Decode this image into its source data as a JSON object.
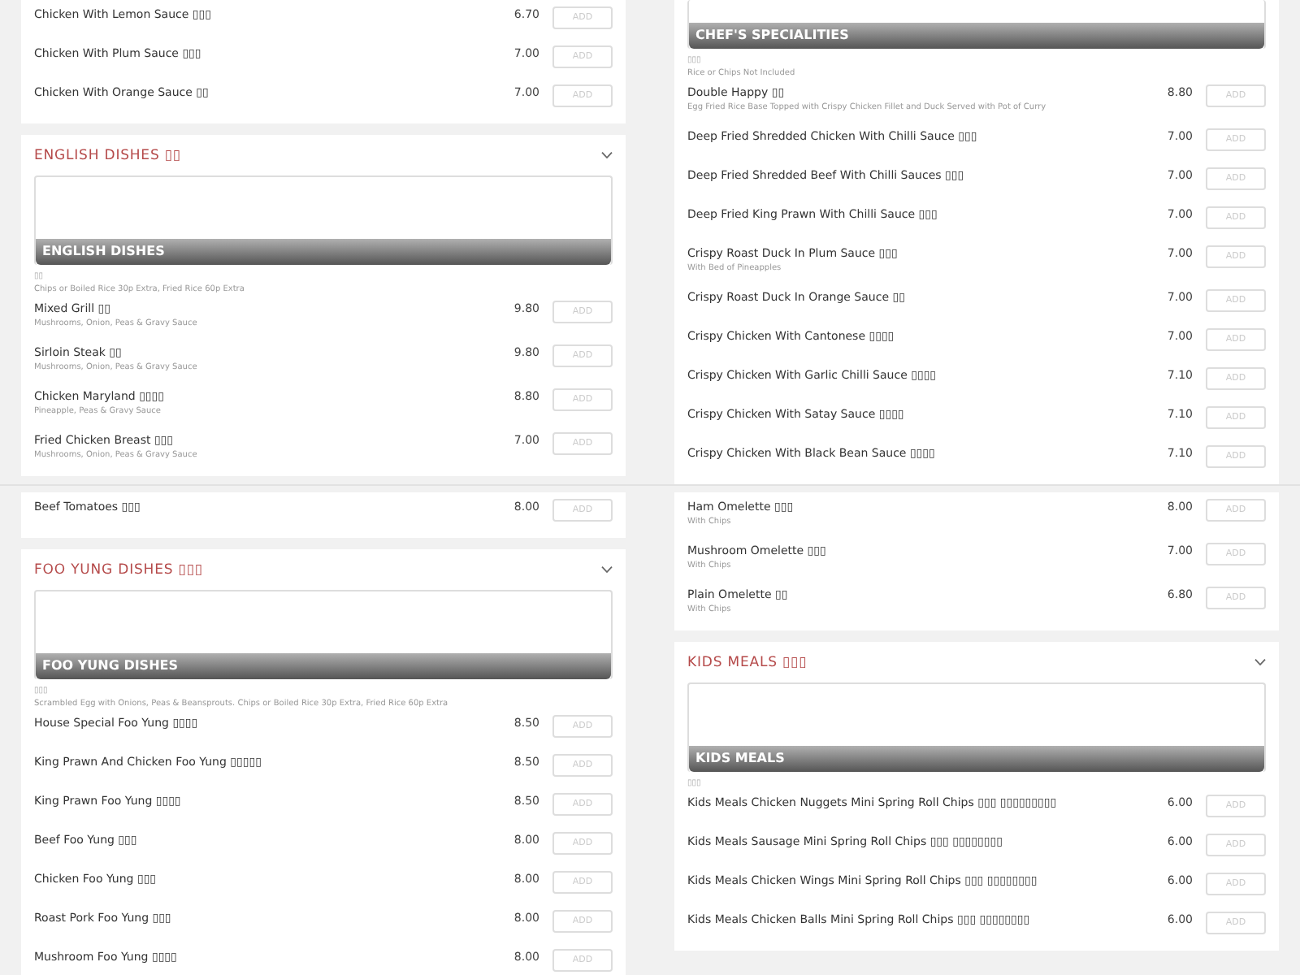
{
  "views": [
    {
      "left": [
        {
          "items": [
            {
              "name": "Chicken With Lemon Sauce ▯▯▯",
              "price": "6.70",
              "button": "ADD"
            },
            {
              "name": "Chicken With Plum Sauce ▯▯▯",
              "price": "7.00",
              "button": "ADD"
            },
            {
              "name": "Chicken With Orange Sauce ▯▯",
              "price": "7.00",
              "button": "ADD"
            }
          ]
        },
        {
          "title": "ENGLISH DISHES ▯▯",
          "banner": "ENGLISH DISHES",
          "chinese": "▯▯",
          "note": "Chips or Boiled Rice 30p Extra, Fried Rice 60p Extra",
          "items": [
            {
              "name": "Mixed Grill ▯▯",
              "sub": "Mushrooms, Onion, Peas & Gravy Sauce",
              "price": "9.80",
              "button": "ADD"
            },
            {
              "name": "Sirloin Steak ▯▯",
              "sub": "Mushrooms, Onion, Peas & Gravy Sauce",
              "price": "9.80",
              "button": "ADD"
            },
            {
              "name": "Chicken Maryland ▯▯▯▯",
              "sub": "Pineapple, Peas & Gravy Sauce",
              "price": "8.80",
              "button": "ADD"
            },
            {
              "name": "Fried Chicken Breast ▯▯▯",
              "sub": "Mushrooms, Onion, Peas & Gravy Sauce",
              "price": "7.00",
              "button": "ADD"
            }
          ]
        }
      ],
      "right": [
        {
          "banner": "CHEF'S SPECIALITIES",
          "chinese": "▯▯▯",
          "note": "Rice or Chips Not Included",
          "items": [
            {
              "name": "Double Happy ▯▯",
              "sub": "Egg Fried Rice Base Topped with Crispy Chicken Fillet and Duck Served with Pot of Curry",
              "price": "8.80",
              "button": "ADD"
            },
            {
              "name": "Deep Fried Shredded Chicken With Chilli Sauce ▯▯▯",
              "price": "7.00",
              "button": "ADD"
            },
            {
              "name": "Deep Fried Shredded Beef With Chilli Sauces ▯▯▯",
              "price": "7.00",
              "button": "ADD"
            },
            {
              "name": "Deep Fried King Prawn With Chilli Sauce ▯▯▯",
              "price": "7.00",
              "button": "ADD"
            },
            {
              "name": "Crispy Roast Duck In Plum Sauce ▯▯▯",
              "sub": "With Bed of Pineapples",
              "price": "7.00",
              "button": "ADD"
            },
            {
              "name": "Crispy Roast Duck In Orange Sauce ▯▯",
              "price": "7.00",
              "button": "ADD"
            },
            {
              "name": "Crispy Chicken With Cantonese ▯▯▯▯",
              "price": "7.00",
              "button": "ADD"
            },
            {
              "name": "Crispy Chicken With Garlic Chilli Sauce ▯▯▯▯",
              "price": "7.10",
              "button": "ADD"
            },
            {
              "name": "Crispy Chicken With Satay Sauce ▯▯▯▯",
              "price": "7.10",
              "button": "ADD"
            },
            {
              "name": "Crispy Chicken With Black Bean Sauce ▯▯▯▯",
              "price": "7.10",
              "button": "ADD"
            }
          ]
        }
      ]
    },
    {
      "left": [
        {
          "items": [
            {
              "name": "Beef Tomatoes ▯▯▯",
              "price": "8.00",
              "button": "ADD"
            }
          ]
        },
        {
          "title": "FOO YUNG DISHES ▯▯▯",
          "banner": "FOO YUNG DISHES",
          "chinese": "▯▯▯",
          "note": "Scrambled Egg with Onions, Peas & Beansprouts. Chips or Boiled Rice 30p Extra, Fried Rice 60p Extra",
          "items": [
            {
              "name": "House Special Foo Yung ▯▯▯▯",
              "price": "8.50",
              "button": "ADD"
            },
            {
              "name": "King Prawn And Chicken Foo Yung ▯▯▯▯▯",
              "price": "8.50",
              "button": "ADD"
            },
            {
              "name": "King Prawn Foo Yung ▯▯▯▯",
              "price": "8.50",
              "button": "ADD"
            },
            {
              "name": "Beef Foo Yung ▯▯▯",
              "price": "8.00",
              "button": "ADD"
            },
            {
              "name": "Chicken Foo Yung ▯▯▯",
              "price": "8.00",
              "button": "ADD"
            },
            {
              "name": "Roast Pork Foo Yung ▯▯▯",
              "price": "8.00",
              "button": "ADD"
            },
            {
              "name": "Mushroom Foo Yung ▯▯▯▯",
              "price": "8.00",
              "button": "ADD"
            }
          ]
        }
      ],
      "right": [
        {
          "items": [
            {
              "name": "Ham Omelette ▯▯▯",
              "sub": "With Chips",
              "price": "8.00",
              "button": "ADD"
            },
            {
              "name": "Mushroom Omelette ▯▯▯",
              "sub": "With Chips",
              "price": "7.00",
              "button": "ADD"
            },
            {
              "name": "Plain Omelette ▯▯",
              "sub": "With Chips",
              "price": "6.80",
              "button": "ADD"
            }
          ]
        },
        {
          "title": "KIDS MEALS ▯▯▯",
          "banner": "KIDS MEALS",
          "chinese": "▯▯▯",
          "items": [
            {
              "name": "Kids Meals Chicken Nuggets Mini Spring Roll Chips ▯▯▯ ▯▯▯▯▯▯▯▯▯",
              "price": "6.00",
              "button": "ADD"
            },
            {
              "name": "Kids Meals Sausage Mini Spring Roll Chips ▯▯▯ ▯▯▯▯▯▯▯▯",
              "price": "6.00",
              "button": "ADD"
            },
            {
              "name": "Kids Meals Chicken Wings Mini Spring Roll Chips ▯▯▯ ▯▯▯▯▯▯▯▯",
              "price": "6.00",
              "button": "ADD"
            },
            {
              "name": "Kids Meals Chicken Balls Mini Spring Roll Chips ▯▯▯ ▯▯▯▯▯▯▯▯",
              "price": "6.00",
              "button": "ADD"
            }
          ]
        }
      ]
    }
  ]
}
